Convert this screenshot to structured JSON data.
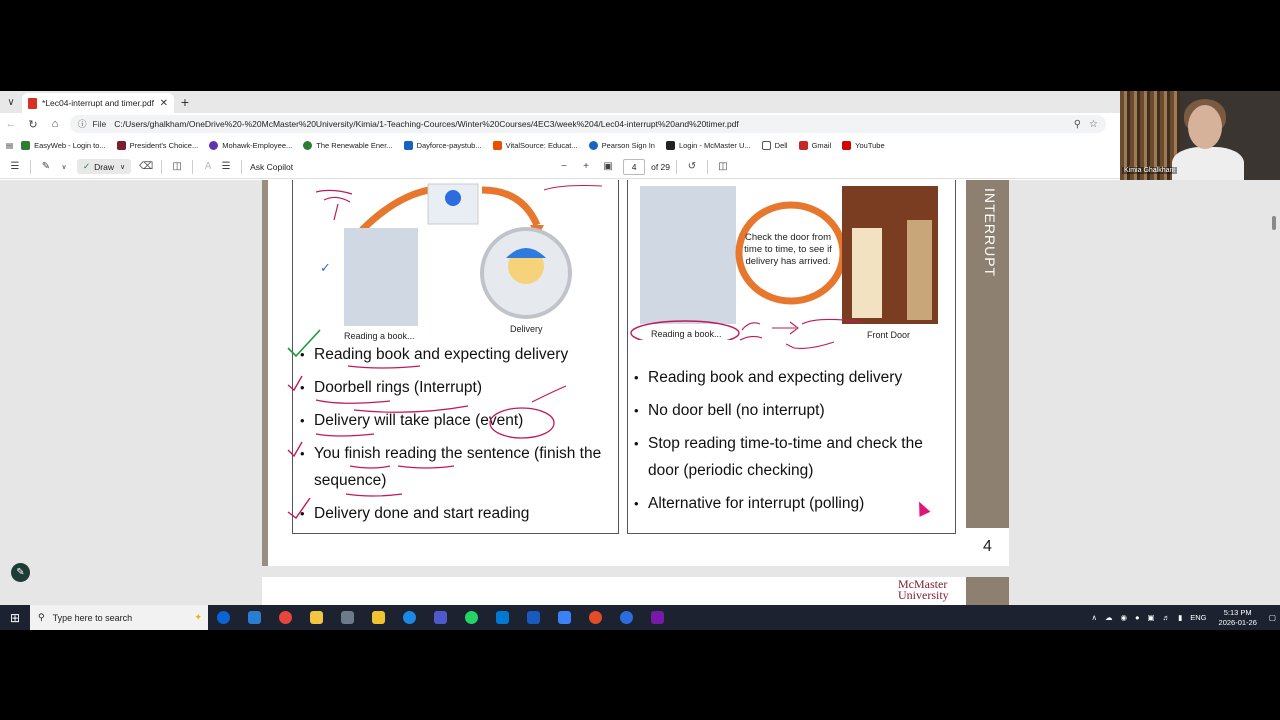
{
  "browser": {
    "tab_title": "*Lec04-interrupt and timer.pdf",
    "address_prefix": "File",
    "url": "C:/Users/ghalkham/OneDrive%20-%20McMaster%20University/Kimia/1-Teaching-Cources/Winter%20Courses/4EC3/week%204/Lec04-interrupt%20and%20timer.pdf",
    "bookmarks": [
      {
        "label": "EasyWeb - Login to...",
        "color": "#2e7d32"
      },
      {
        "label": "President's Choice...",
        "color": "#7b1f2a"
      },
      {
        "label": "Mohawk-Employee...",
        "color": "#5e35b1"
      },
      {
        "label": "The Renewable Ener...",
        "color": "#2e7d32"
      },
      {
        "label": "Dayforce-paystub...",
        "color": "#1565c0"
      },
      {
        "label": "VitalSource: Educat...",
        "color": "#e65100"
      },
      {
        "label": "Pearson Sign In",
        "color": "#1565c0"
      },
      {
        "label": "Login - McMaster U...",
        "color": "#222222"
      },
      {
        "label": "Dell",
        "color": "#555555"
      },
      {
        "label": "Gmail",
        "color": "#c62828"
      },
      {
        "label": "YouTube",
        "color": "#d50000"
      }
    ]
  },
  "pdf_toolbar": {
    "draw_label": "Draw",
    "copilot_label": "Ask Copilot",
    "page_current": "4",
    "page_total": "of 29"
  },
  "slide": {
    "side_title": "INTERRUPT",
    "page_number": "4",
    "left_captions": {
      "reading": "Reading a book...",
      "delivery": "Delivery"
    },
    "right_captions": {
      "ring_text": "Check the door from time to time, to see if delivery has arrived.",
      "reading": "Reading a book...",
      "front_door": "Front Door"
    },
    "left_bullets": [
      "Reading book and expecting delivery",
      "Doorbell rings (Interrupt)",
      "Delivery will take place (event)",
      "You finish reading the sentence (finish the sequence)",
      "Delivery done and start reading"
    ],
    "right_bullets": [
      "Reading book and expecting delivery",
      "No door bell (no interrupt)",
      "Stop reading time-to-time and check the door (periodic checking)",
      "Alternative for interrupt (polling)"
    ],
    "next_page_logo": "McMaster University"
  },
  "webcam": {
    "name": "Kimia Ghalkhani"
  },
  "taskbar": {
    "search_placeholder": "Type here to search",
    "lang": "ENG",
    "time": "5:13 PM",
    "date": "2026-01-26",
    "apps": [
      "#0a64d8",
      "#2b7cd3",
      "#e8453c",
      "#f4c542",
      "#6c7a89",
      "#f1c232",
      "#1e88e5",
      "#5059c9",
      "#25d366",
      "#0078d4",
      "#185abd",
      "#3b82f6",
      "#e34c26",
      "#2d6cdf",
      "#7719aa"
    ]
  }
}
